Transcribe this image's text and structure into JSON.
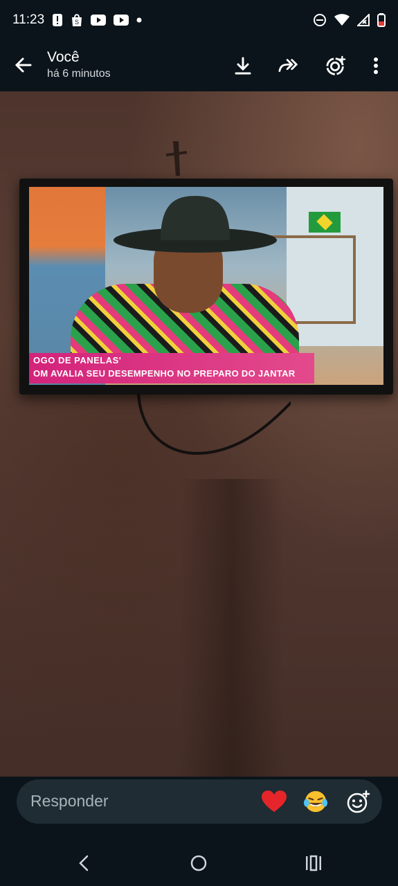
{
  "status_bar": {
    "time": "11:23",
    "icons_left": [
      "alert-icon",
      "shopee-icon",
      "youtube-icon",
      "youtube-icon",
      "dot-icon"
    ],
    "icons_right": [
      "dnd-icon",
      "wifi-icon",
      "signal-icon",
      "battery-icon"
    ]
  },
  "header": {
    "title": "Você",
    "subtitle": "há 6 minutos",
    "actions": [
      "download-icon",
      "forward-icon",
      "status-add-icon",
      "more-vert-icon"
    ]
  },
  "photo": {
    "tv_banner_line1": "OGO DE PANELAS'",
    "tv_banner_line2": "OM AVALIA SEU DESEMPENHO NO PREPARO DO JANTAR"
  },
  "reply": {
    "placeholder": "Responder",
    "reactions": [
      "heart",
      "joy",
      "add-emoji"
    ]
  },
  "colors": {
    "background": "#0b141a",
    "reply_bar": "#1f2c33",
    "banner": "#d3237b"
  }
}
